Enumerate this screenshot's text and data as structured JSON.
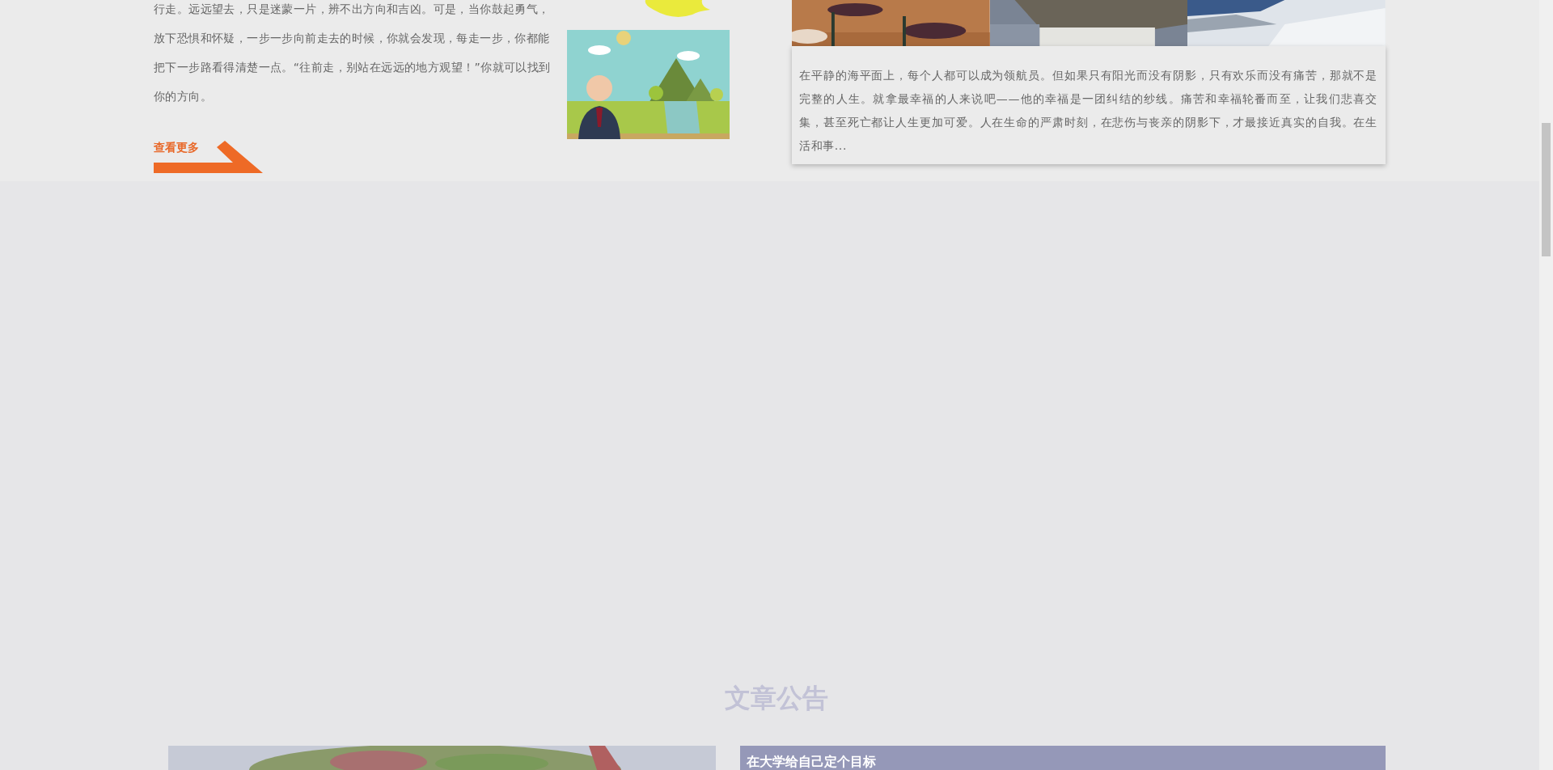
{
  "article_intro": {
    "paragraph": "行走。远远望去，只是迷蒙一片，辨不出方向和吉凶。可是，当你鼓起勇气，放下恐惧和怀疑，一步一步向前走去的时候，你就会发现，每走一步，你都能把下一步路看得清楚一点。“往前走，别站在远远的地方观望！”你就可以找到你的方向。",
    "more_link": "查看更多"
  },
  "featured": {
    "excerpt": "在平静的海平面上，每个人都可以成为领航员。但如果只有阳光而没有阴影，只有欢乐而没有痛苦，那就不是完整的人生。就拿最幸福的人来说吧——他的幸福是一团纠结的纱线。痛苦和幸福轮番而至，让我们悲喜交集，甚至死亡都让人生更加可爱。人在生命的严肃时刻，在悲伤与丧亲的阴影下，才最接近真实的自我。在生活和事..."
  },
  "announcements": {
    "title": "文章公告",
    "cards": [
      {
        "title": "在大学给自己定个目标"
      }
    ]
  }
}
